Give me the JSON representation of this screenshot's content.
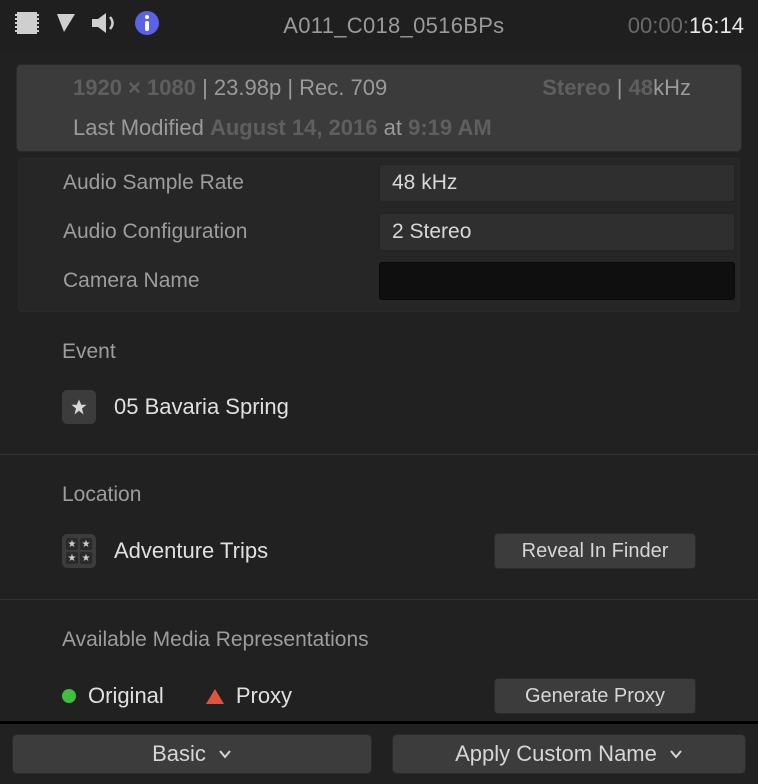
{
  "header": {
    "clip_name": "A011_C018_0516BPs",
    "timecode_dim": "00:00:",
    "timecode_bright": "16:14"
  },
  "summary": {
    "resolution": "1920 × 1080",
    "frame_rate": "23.98p",
    "color_space": "Rec. 709",
    "audio_mode": "Stereo",
    "audio_rate": "48",
    "audio_rate_unit": "kHz",
    "modified_prefix": "Last Modified",
    "modified_date": "August 14, 2016",
    "modified_at": "at",
    "modified_time": "9:19 AM"
  },
  "props": {
    "audio_sample_rate_label": "Audio Sample Rate",
    "audio_sample_rate_value": "48 kHz",
    "audio_config_label": "Audio Configuration",
    "audio_config_value": "2 Stereo",
    "camera_name_label": "Camera Name",
    "camera_name_value": ""
  },
  "event": {
    "title": "Event",
    "name": "05 Bavaria Spring"
  },
  "location": {
    "title": "Location",
    "name": "Adventure Trips",
    "reveal_label": "Reveal In Finder"
  },
  "media": {
    "title": "Available Media Representations",
    "original_label": "Original",
    "proxy_label": "Proxy",
    "generate_label": "Generate Proxy"
  },
  "footer": {
    "view_mode": "Basic",
    "apply_label": "Apply Custom Name"
  }
}
